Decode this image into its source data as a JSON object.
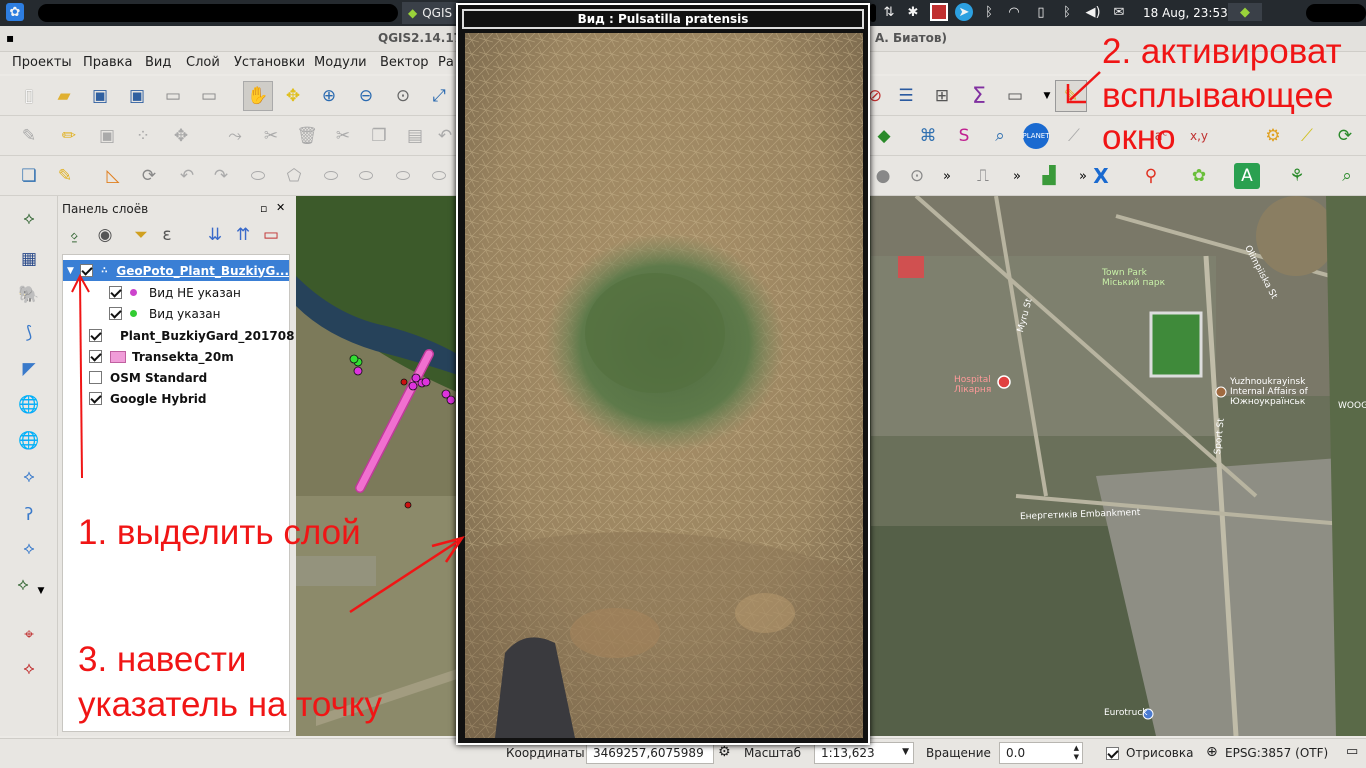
{
  "taskbar": {
    "qgis_tab_label": "QGIS",
    "clock": "18 Aug, 23:53"
  },
  "window": {
    "title_left": "QGIS2.14.17-",
    "title_right": "А. Биатов)"
  },
  "menu": {
    "items": [
      "Проекты",
      "Правка",
      "Вид",
      "Слой",
      "Установки",
      "Модули",
      "Вектор",
      "Ра"
    ]
  },
  "layers_panel": {
    "title": "Панель слоёв",
    "layers": [
      {
        "name": "GeoPoto_Plant_BuzkiyG...",
        "checked": true,
        "selected": true,
        "expanded": true,
        "bold": true
      },
      {
        "name": "Вид НЕ указан",
        "checked": true,
        "symbol_color": "#cc44cc",
        "child": true
      },
      {
        "name": "Вид указан",
        "checked": true,
        "symbol_color": "#33cc33",
        "child": true
      },
      {
        "name": "Plant_BuzkiyGard_201708",
        "checked": true,
        "symbol_color": "#cc1111",
        "bold": true
      },
      {
        "name": "Transekta_20m",
        "checked": true,
        "symbol_color": "#f09cd8",
        "bold": true
      },
      {
        "name": "OSM Standard",
        "checked": false,
        "bold": true
      },
      {
        "name": "Google Hybrid",
        "checked": true,
        "bold": true
      }
    ]
  },
  "popup": {
    "title": "Вид : Pulsatilla pratensis"
  },
  "map_labels": {
    "olimpiiska": "Olimpiiska St",
    "myru": "Myru St",
    "town_park": "Town Park",
    "town_park_ua": "Міський парк",
    "hospital": "Hospital",
    "hospital_ua": "Лікарня",
    "yuzhno": "Yuzhnoukrayinsk",
    "internal_affairs": "Internal Affairs of",
    "yuzhno_ua": "Южноукраїнськ",
    "embankment": "Енергетиків Embankment",
    "eurotruck": "Eurotruck",
    "woog": "WOOG",
    "sport": "Sport St"
  },
  "annotations": {
    "step1": "1. выделить слой",
    "step2_line1": "2. активироват",
    "step2_line2": "всплывающее",
    "step2_line3": "окно",
    "step3_line1": "3. навести",
    "step3_line2": "указатель на точку"
  },
  "statusbar": {
    "coord_label": "Координаты",
    "coord_value": "3469257,6075989",
    "scale_label": "Масштаб",
    "scale_value": "1:13,623",
    "rotation_label": "Вращение",
    "rotation_value": "0.0",
    "render_label": "Отрисовка",
    "crs": "EPSG:3857 (OTF)"
  },
  "colors": {
    "annotation_red": "#f01515",
    "selected_layer": "#3a7fd5",
    "taskbar": "#252a2f"
  }
}
